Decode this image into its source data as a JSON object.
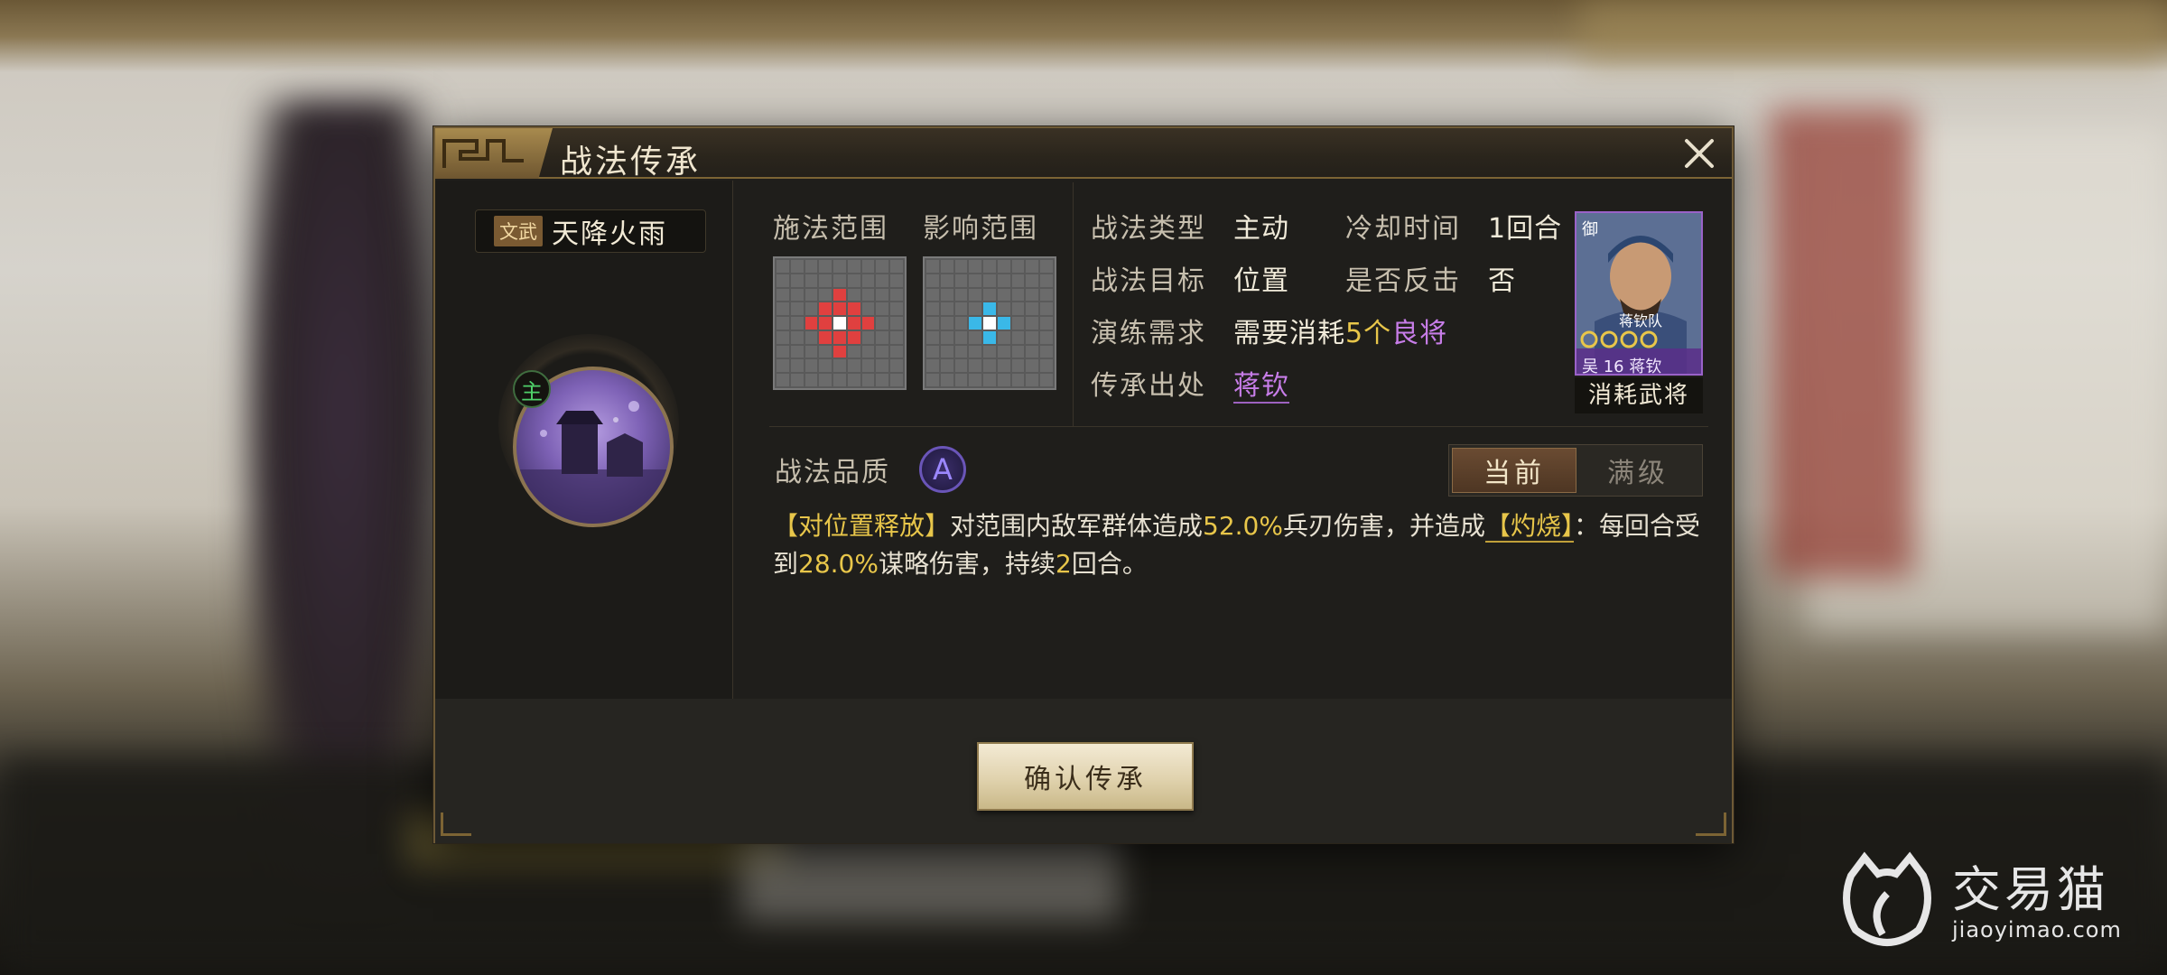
{
  "dialog": {
    "title": "战法传承"
  },
  "skill": {
    "tag": "文武",
    "name": "天降火雨",
    "main_badge": "主"
  },
  "range": {
    "cast_label": "施法范围",
    "effect_label": "影响范围"
  },
  "info": {
    "type_label": "战法类型",
    "type_value": "主动",
    "cooldown_label": "冷却时间",
    "cooldown_value": "1回合",
    "target_label": "战法目标",
    "target_value": "位置",
    "counter_label": "是否反击",
    "counter_value": "否",
    "train_label": "演练需求",
    "train_prefix": "需要消耗",
    "train_count": "5个",
    "train_item": "良将",
    "source_label": "传承出处",
    "source_value": "蒋钦"
  },
  "general_card": {
    "top_left": "御",
    "name_inside": "蒋钦队",
    "bottom": "吴 16 蒋钦",
    "caption": "消耗武将"
  },
  "quality": {
    "label": "战法品质",
    "grade": "A"
  },
  "tabs": [
    {
      "label": "当前",
      "active": true
    },
    {
      "label": "满级",
      "active": false
    }
  ],
  "description": {
    "part1": "【对位置释放】",
    "part2": "对范围内敌军群体造成",
    "value1": "52.0%",
    "part3": "兵刃伤害，并造成",
    "status": "【灼烧】",
    "part4": "：每回合受到",
    "value2": "28.0%",
    "part5": "谋略伤害，持续",
    "turns": "2",
    "part6": "回合。"
  },
  "confirm_button": "确认传承",
  "watermark": {
    "cn": "交易猫",
    "en": "jiaoyimao.com"
  },
  "colors": {
    "cast_range": "#e0403f",
    "effect_range": "#3ab8e8",
    "highlight_yellow": "#e8c64a",
    "highlight_purple": "#c77de8"
  }
}
